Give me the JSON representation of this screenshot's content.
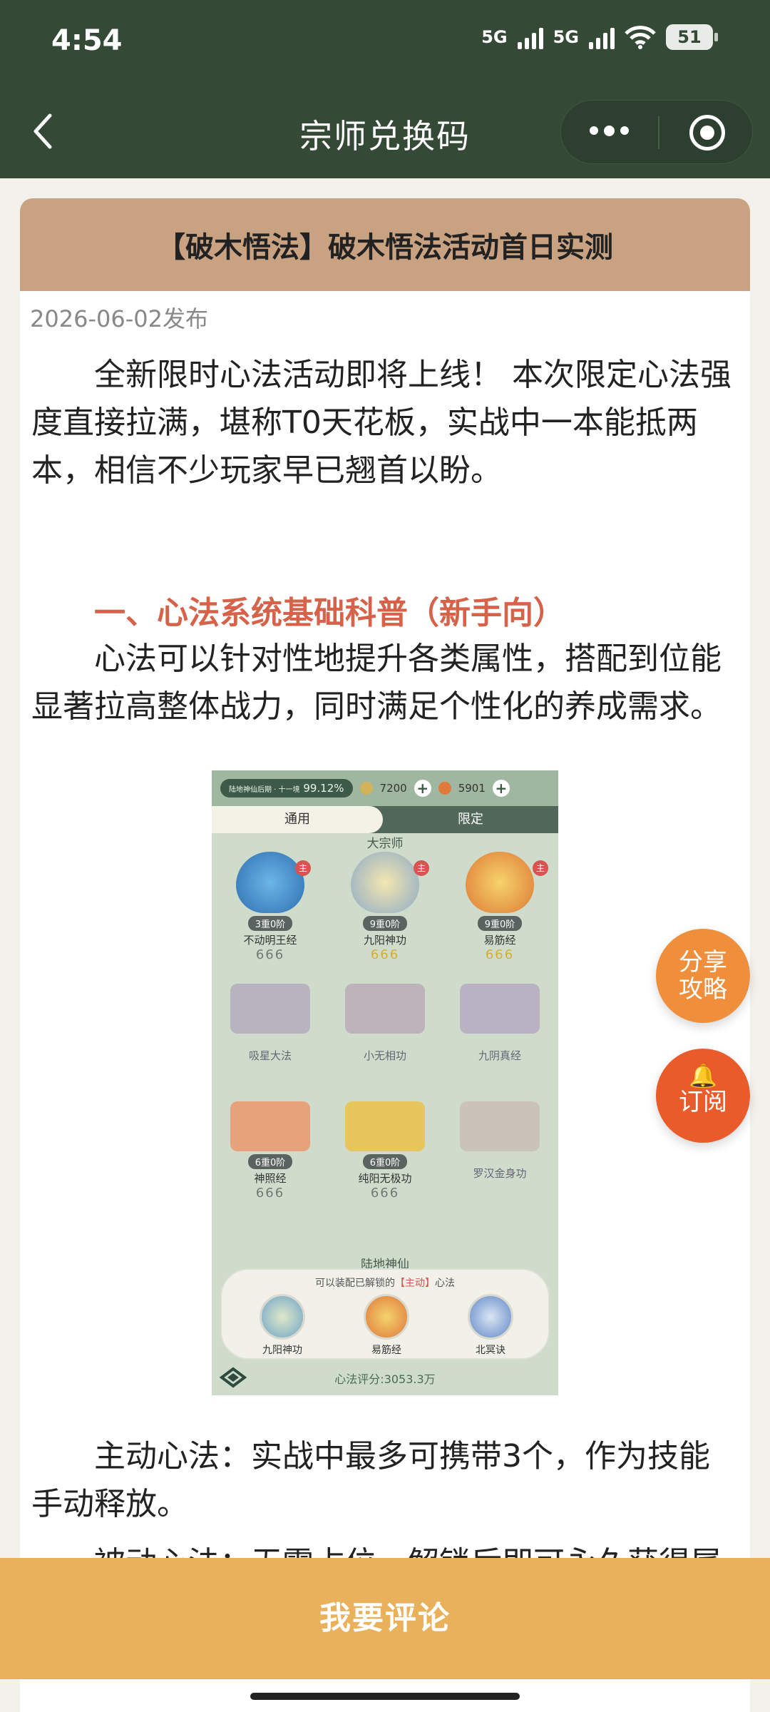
{
  "status_bar": {
    "time": "4:54",
    "net1": "5G",
    "net2": "5G",
    "battery": "51"
  },
  "nav": {
    "title": "宗师兑换码"
  },
  "article": {
    "title": "【破木悟法】破木悟法活动首日实测",
    "date": "2026-06-02发布",
    "p1": "全新限时心法活动即将上线！ 本次限定心法强度直接拉满，堪称T0天花板，实战中一本能抵两本，相信不少玩家早已翘首以盼。",
    "heading1": "一、心法系统基础科普（新手向）",
    "p2": "心法可以针对性地提升各类属性，搭配到位能显著拉高整体战力，同时满足个性化的养成需求。",
    "p3": "主动心法：实战中最多可携带3个，作为技能手动释放。",
    "p4": "被动心法：无需占位，解锁后即可永久获得属"
  },
  "game_shot": {
    "player_label": "陆地神仙后期 · 十一境",
    "player_pct": "99.12%",
    "currency1": "7200",
    "currency2": "5901",
    "tab_general": "通用",
    "tab_limited": "限定",
    "section_top": "大宗师",
    "section_bottom": "陆地神仙",
    "badge": "主",
    "skills": [
      {
        "name": "不动明王经",
        "level": "3重0阶",
        "drops": "666"
      },
      {
        "name": "九阳神功",
        "level": "9重0阶",
        "drops": "666"
      },
      {
        "name": "易筋经",
        "level": "9重0阶",
        "drops": "666"
      },
      {
        "name": "吸星大法"
      },
      {
        "name": "小无相功"
      },
      {
        "name": "九阴真经"
      },
      {
        "name": "神照经",
        "level": "6重0阶",
        "drops": "666"
      },
      {
        "name": "纯阳无极功",
        "level": "6重0阶",
        "drops": "666"
      },
      {
        "name": "罗汉金身功"
      }
    ],
    "equip_prefix": "可以装配已解锁的",
    "equip_tag": "【主动】",
    "equip_suffix": "心法",
    "equipped": [
      "九阳神功",
      "易筋经",
      "北冥诀"
    ],
    "score": "心法评分:3053.3万"
  },
  "fab": {
    "share_line1": "分享",
    "share_line2": "攻略",
    "subscribe": "订阅"
  },
  "footer": {
    "comment": "我要评论"
  }
}
